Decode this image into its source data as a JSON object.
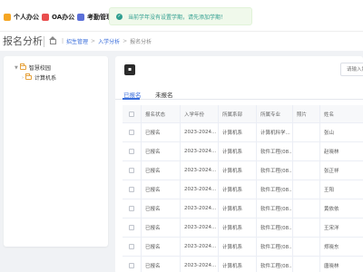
{
  "topnav": {
    "items": [
      {
        "label": "个人办公",
        "icon": "person-icon"
      },
      {
        "label": "OA办公",
        "icon": "oa-icon"
      },
      {
        "label": "考勤管理",
        "icon": "clock-icon"
      }
    ]
  },
  "toast": {
    "text": "当前学年没有设置学期，请先添加学期！",
    "icon": "check-circle-icon",
    "color": "#2f9e8f"
  },
  "page": {
    "title": "报名分析",
    "breadcrumb": [
      "招生管理",
      "入学分析",
      "报名分析"
    ]
  },
  "tree": {
    "root": "智慧校园",
    "child": "计算机系"
  },
  "toolbar": {
    "icon_button": "▪",
    "search_placeholder": "请输入姓名"
  },
  "tabs": [
    {
      "label": "已报名",
      "active": true
    },
    {
      "label": "未报名",
      "active": false
    }
  ],
  "table": {
    "columns": [
      "报名状态",
      "入学年份",
      "所属系部",
      "所属专业",
      "照片",
      "姓名"
    ],
    "rows": [
      [
        "已报名",
        "2023-2024...",
        "计算机系",
        "计算机科学...",
        "",
        "张山"
      ],
      [
        "已报名",
        "2023-2024...",
        "计算机系",
        "软件工程(08...",
        "",
        "赵晓林"
      ],
      [
        "已报名",
        "2023-2024...",
        "计算机系",
        "软件工程(08...",
        "",
        "张正祥"
      ],
      [
        "已报名",
        "2023-2024...",
        "计算机系",
        "软件工程(08...",
        "",
        "王阳"
      ],
      [
        "已报名",
        "2023-2024...",
        "计算机系",
        "软件工程(08...",
        "",
        "黄依依"
      ],
      [
        "已报名",
        "2023-2024...",
        "计算机系",
        "软件工程(08...",
        "",
        "王宋洋"
      ],
      [
        "已报名",
        "2023-2024...",
        "计算机系",
        "软件工程(08...",
        "",
        "郑晓东"
      ],
      [
        "已报名",
        "2023-2024...",
        "计算机系",
        "软件工程(08...",
        "",
        "唐晓林"
      ]
    ]
  },
  "colors": {
    "accent": "#3a6edb",
    "background": "#f0f2f5"
  }
}
